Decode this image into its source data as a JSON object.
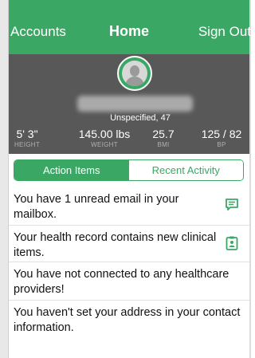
{
  "nav": {
    "accounts": "Accounts",
    "title": "Home",
    "signout": "Sign Out"
  },
  "profile": {
    "subtitle": "Unspecified, 47",
    "stats": [
      {
        "value": "5' 3\"",
        "label": "HEIGHT"
      },
      {
        "value": "145.00 lbs",
        "label": "WEIGHT"
      },
      {
        "value": "25.7",
        "label": "BMI"
      },
      {
        "value": "125 / 82",
        "label": "BP"
      }
    ]
  },
  "tabs": {
    "action": "Action Items",
    "recent": "Recent Activity",
    "selected": "Action Items"
  },
  "items": [
    {
      "text": "You have 1 unread email in your mailbox.",
      "icon": "message-icon"
    },
    {
      "text": "Your health record contains new clinical items.",
      "icon": "clipboard-icon"
    },
    {
      "text": "You have not connected to any healthcare providers!"
    },
    {
      "text": "You haven't set your address in your contact information."
    }
  ],
  "colors": {
    "accent": "#3aa864",
    "profile_bg": "#585858"
  }
}
